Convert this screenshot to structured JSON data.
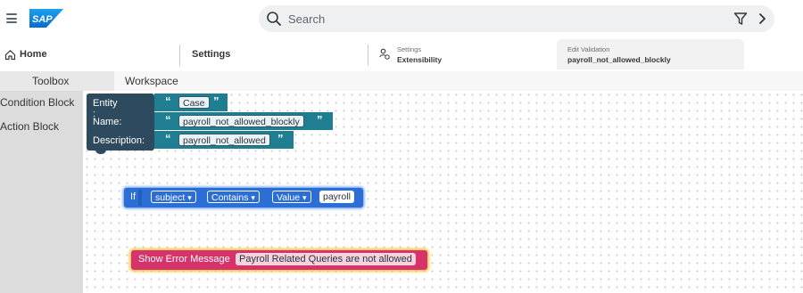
{
  "header": {
    "logo_text": "SAP",
    "search_placeholder": "Search"
  },
  "tabs": {
    "home": "Home",
    "settings": "Settings",
    "extensibility_small": "Settings",
    "extensibility_title": "Extensibility",
    "edit_small": "Edit Validation",
    "edit_title": "payroll_not_allowed_blockly"
  },
  "toolbox": {
    "header": "Toolbox",
    "categories": [
      "Condition Block",
      "Action Block"
    ]
  },
  "workspace": {
    "header": "Workspace"
  },
  "entity_block": {
    "entity_label": "Entity :",
    "entity_value": "Case",
    "name_label": "Name:",
    "name_value": "payroll_not_allowed_blockly",
    "description_label": "Description:",
    "description_value": "payroll_not_allowed",
    "quote_open": "“",
    "quote_close": "”"
  },
  "if_block": {
    "keyword": "If",
    "field": "subject",
    "operator": "Contains",
    "value_type": "Value",
    "value": "payroll",
    "dropdown_arrow": "▾"
  },
  "action_block": {
    "label": "Show Error Message",
    "message": "Payroll Related Queries are not allowed"
  },
  "colors": {
    "entity_dark": "#2e4a5e",
    "entity_teal": "#1f7e92",
    "if_blue": "#2b6fd6",
    "error_pink": "#d6336c",
    "error_glow": "#f3c33c"
  }
}
